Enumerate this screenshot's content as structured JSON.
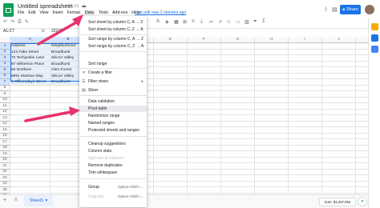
{
  "app": {
    "title": "Untitled spreadsheet",
    "menu": [
      "File",
      "Edit",
      "View",
      "Insert",
      "Format",
      "Data",
      "Tools",
      "Add-ons",
      "Help"
    ],
    "active_menu": "Data",
    "last_edit": "Last edit was 2 minutes ago",
    "share_label": "Share"
  },
  "formula_bar": {
    "name_box": "A1:C7",
    "fx": "fx",
    "value": "22240"
  },
  "columns": [
    "A",
    "B",
    "C",
    "D",
    "E",
    "F",
    "G",
    "H",
    "I",
    "J",
    "K"
  ],
  "rows": [
    "1",
    "2",
    "3",
    "4",
    "5",
    "6",
    "7",
    "8",
    "9",
    "10",
    "11",
    "12",
    "13",
    "14",
    "15",
    "16",
    "17",
    "18",
    "19",
    "20",
    "21",
    "22",
    "23",
    "24",
    "25",
    "26"
  ],
  "table": {
    "headers": [
      "Address",
      "Neighborhood"
    ],
    "rows": [
      [
        "123 Fake Street",
        "Broadhurst"
      ],
      [
        "72 Techjunkie Lane",
        "Silicon Valley"
      ],
      [
        "87 Wilkerson Place",
        "Broadhurst"
      ],
      [
        "65 Northern",
        "Glen Forest"
      ],
      [
        "8991 Manitou Way",
        "Silicon Valley"
      ],
      [
        "1 Offinesdays Street",
        "Broadhurst"
      ]
    ]
  },
  "data_menu": {
    "items": [
      {
        "label": "Sort sheet by column C, A → Z"
      },
      {
        "label": "Sort sheet by column C, Z → A"
      },
      {
        "label": "Sort range by column C, A → Z"
      },
      {
        "label": "Sort range by column C, Z → A"
      },
      {
        "label": "Sort range"
      },
      {
        "label": "Create a filter"
      },
      {
        "label": "Filter views"
      },
      {
        "label": "Slicer"
      },
      {
        "label": "Data validation"
      },
      {
        "label": "Pivot table"
      },
      {
        "label": "Randomize range"
      },
      {
        "label": "Named ranges"
      },
      {
        "label": "Protected sheets and ranges"
      },
      {
        "label": "Cleanup suggestions"
      },
      {
        "label": "Column stats"
      },
      {
        "label": "Split text to columns"
      },
      {
        "label": "Remove duplicates"
      },
      {
        "label": "Trim whitespace"
      },
      {
        "label": "Group"
      },
      {
        "label": "Ungroup"
      }
    ],
    "shortcuts": {
      "group": "Option+Shift+→",
      "ungroup": "Option+Shift+←"
    }
  },
  "sheet_tab": "Sheet1",
  "status_sum": "Sum: $1,257,852",
  "colors": {
    "accent": "#1a73e8",
    "sheets_green": "#0f9d58",
    "annotation_arrow": "#e8336a",
    "selection_fill": "#e8f0fe"
  },
  "icons": [
    "sheets-logo-icon",
    "star-icon",
    "folder-icon",
    "cloud-icon",
    "trend-icon",
    "comment-icon",
    "lock-icon",
    "sort-icon",
    "filter-icon",
    "filter-views-icon",
    "slicer-icon",
    "chevron-right-icon",
    "add-sheet-icon",
    "sheet-list-icon",
    "explore-icon"
  ]
}
